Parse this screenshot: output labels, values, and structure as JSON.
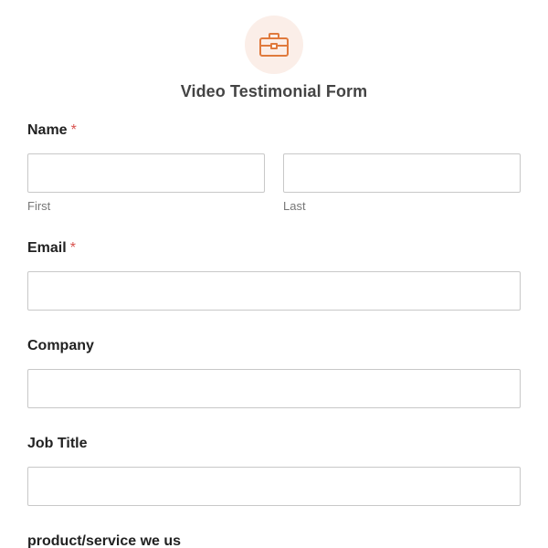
{
  "form": {
    "title": "Video Testimonial Form",
    "accent_color": "#e07a3d",
    "logo_background": "#fbeee8",
    "logo_icon": "briefcase-icon"
  },
  "fields": {
    "name": {
      "label": "Name",
      "required_marker": "*",
      "first_sublabel": "First",
      "last_sublabel": "Last",
      "first_value": "",
      "last_value": ""
    },
    "email": {
      "label": "Email",
      "required_marker": "*",
      "value": ""
    },
    "company": {
      "label": "Company",
      "value": ""
    },
    "job_title": {
      "label": "Job Title",
      "value": ""
    },
    "product_service": {
      "label": "product/service we us"
    }
  }
}
